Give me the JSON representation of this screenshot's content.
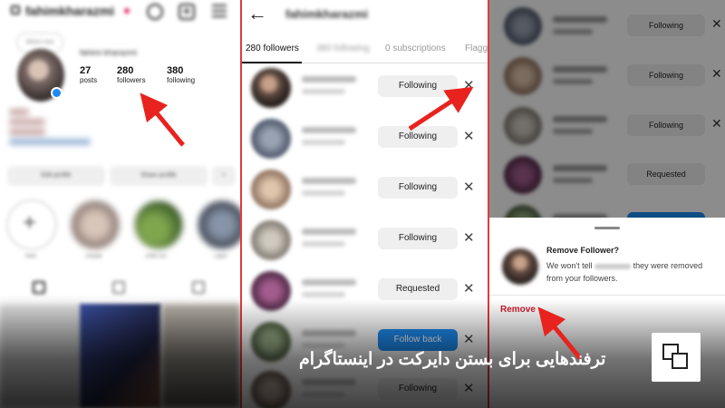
{
  "profile": {
    "username": "fahimkharazmi",
    "full_name": "fahimi kharazmi",
    "note": "What's new",
    "stats": [
      {
        "value": "27",
        "label": "posts"
      },
      {
        "value": "280",
        "label": "followers"
      },
      {
        "value": "380",
        "label": "following"
      }
    ],
    "buttons": [
      "Edit profile",
      "Share profile"
    ],
    "highlights": [
      "New",
      "Tonyda",
      "2088 sss",
      "Lajun"
    ]
  },
  "followers_screen": {
    "title": "fahimkharazmi",
    "tabs": [
      "280 followers",
      "380 following",
      "0 subscriptions",
      "Flagged"
    ],
    "rows": [
      {
        "action": "Following",
        "style": "gray"
      },
      {
        "action": "Following",
        "style": "gray"
      },
      {
        "action": "Following",
        "style": "gray"
      },
      {
        "action": "Following",
        "style": "gray"
      },
      {
        "action": "Requested",
        "style": "gray"
      },
      {
        "action": "Follow back",
        "style": "blue"
      },
      {
        "action": "Following",
        "style": "gray"
      }
    ],
    "remove_icon": "close-icon"
  },
  "remove_screen": {
    "rows": [
      {
        "action": "Following"
      },
      {
        "action": "Following"
      },
      {
        "action": "Following"
      },
      {
        "action": "Requested"
      }
    ],
    "sheet": {
      "title": "Remove Follower?",
      "body_before": "We won't tell",
      "body_after": "they were removed from your followers.",
      "remove_label": "Remove"
    }
  },
  "caption": "ترفندهایی برای بستن دایرکت در اینستاگرام",
  "colors": {
    "accent_red": "#e23b3b",
    "remove_red": "#d11c2c",
    "follow_blue": "#1d8cf2"
  }
}
